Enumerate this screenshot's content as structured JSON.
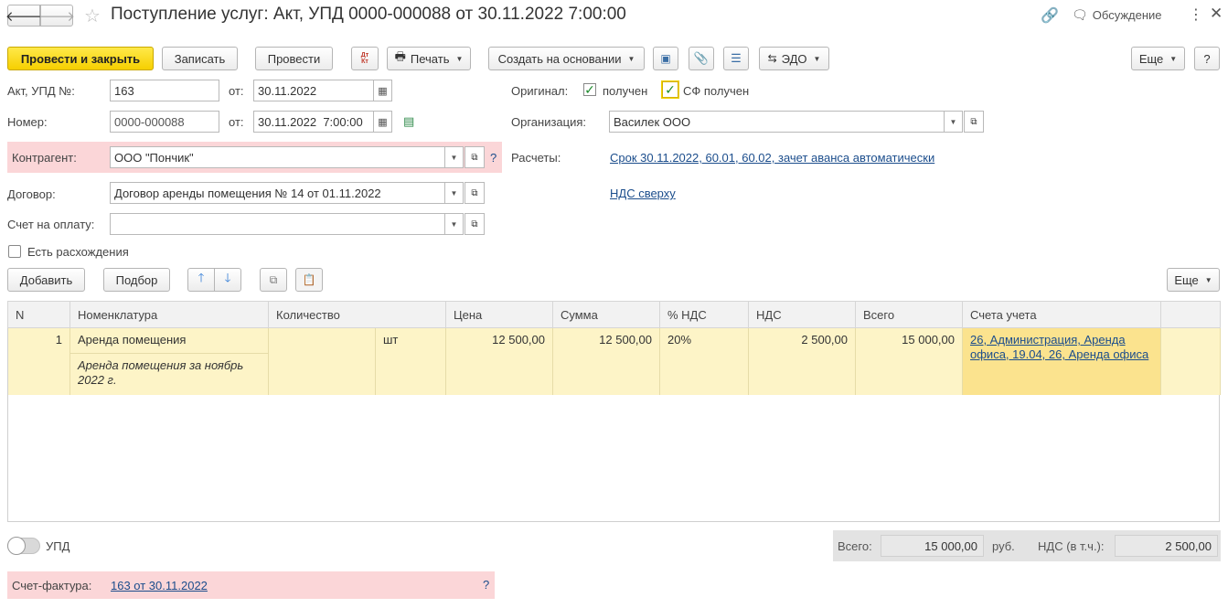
{
  "titlebar": {
    "title": "Поступление услуг: Акт, УПД 0000-000088 от 30.11.2022 7:00:00",
    "discussion": "Обсуждение"
  },
  "toolbar": {
    "post_close": "Провести и закрыть",
    "save": "Записать",
    "post": "Провести",
    "dtkt": "Дт Кт",
    "print": "Печать",
    "create_based": "Создать на основании",
    "edo": "ЭДО",
    "more": "Еще",
    "help": "?"
  },
  "form": {
    "act_label": "Акт, УПД №:",
    "act_value": "163",
    "from_label": "от:",
    "act_date": "30.11.2022",
    "number_label": "Номер:",
    "number_value": "0000-000088",
    "number_date": "30.11.2022  7:00:00",
    "counterparty_label": "Контрагент:",
    "counterparty_value": "ООО \"Пончик\"",
    "counterparty_help": "?",
    "contract_label": "Договор:",
    "contract_value": "Договор аренды помещения № 14 от 01.11.2022",
    "invoice_pay_label": "Счет на оплату:",
    "invoice_pay_value": "",
    "discrepancy_label": "Есть расхождения",
    "original_label": "Оригинал:",
    "received_label": "получен",
    "sf_received_label": "СФ получен",
    "org_label": "Организация:",
    "org_value": "Василек ООО",
    "settlements_label": "Расчеты:",
    "settlements_link": "Срок 30.11.2022, 60.01, 60.02, зачет аванса автоматически",
    "vat_link": "НДС сверху"
  },
  "table_toolbar": {
    "add": "Добавить",
    "pick": "Подбор",
    "more": "Еще"
  },
  "table": {
    "headers": [
      "N",
      "Номенклатура",
      "Количество",
      "Цена",
      "Сумма",
      "% НДС",
      "НДС",
      "Всего",
      "Счета учета"
    ],
    "rows": [
      {
        "n": "1",
        "name": "Аренда помещения",
        "description": "Аренда помещения за ноябрь 2022 г.",
        "qty": "",
        "unit": "шт",
        "price": "12 500,00",
        "sum": "12 500,00",
        "vat_rate": "20%",
        "vat": "2 500,00",
        "total": "15 000,00",
        "accounts": "26, Администрация, Аренда офиса, 19.04, 26, Аренда офиса"
      }
    ]
  },
  "footer": {
    "upd_label": "УПД",
    "total_label": "Всего:",
    "total_value": "15 000,00",
    "currency": "руб.",
    "vat_incl_label": "НДС (в т.ч.):",
    "vat_incl_value": "2 500,00",
    "invoice_label": "Счет-фактура:",
    "invoice_link": "163 от 30.11.2022",
    "invoice_help": "?"
  },
  "colors": {
    "accent_yellow": "#f6cf00",
    "highlight_pink": "#fbd6d8",
    "row_yellow": "#fdf4c7",
    "link_blue": "#1b4d8c"
  }
}
